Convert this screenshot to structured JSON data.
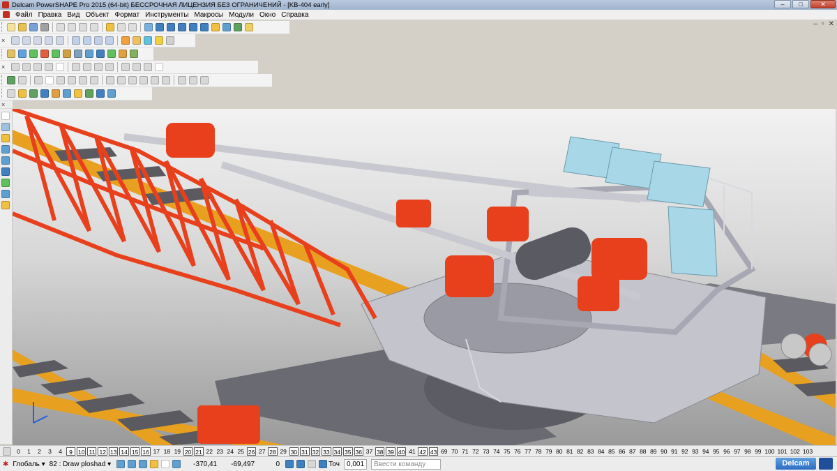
{
  "window": {
    "title": "Delcam PowerSHAPE Pro 2015 (64-bit) БЕССРОЧНАЯ ЛИЦЕНЗИЯ БЕЗ ОГРАНИЧЕНИЙ - [KB-404 early]",
    "min": "–",
    "max": "□",
    "close": "✕"
  },
  "menu": [
    "Файл",
    "Правка",
    "Вид",
    "Объект",
    "Формат",
    "Инструменты",
    "Макросы",
    "Модули",
    "Окно",
    "Справка"
  ],
  "mdi_controls": {
    "min": "–",
    "restore": "▫",
    "close": "✕"
  },
  "toolbar_close": "×",
  "levels": [
    "0",
    "1",
    "2",
    "3",
    "4",
    "9",
    "10",
    "11",
    "12",
    "13",
    "14",
    "15",
    "16",
    "17",
    "18",
    "19",
    "20",
    "21",
    "22",
    "23",
    "24",
    "25",
    "26",
    "27",
    "28",
    "29",
    "30",
    "31",
    "32",
    "33",
    "34",
    "35",
    "36",
    "37",
    "38",
    "39",
    "40",
    "41",
    "42",
    "43",
    "69",
    "70",
    "71",
    "72",
    "73",
    "74",
    "75",
    "76",
    "77",
    "78",
    "79",
    "80",
    "81",
    "82",
    "83",
    "84",
    "85",
    "86",
    "87",
    "88",
    "89",
    "90",
    "91",
    "92",
    "93",
    "94",
    "95",
    "96",
    "97",
    "98",
    "99",
    "100",
    "101",
    "102",
    "103"
  ],
  "levels_on": [
    "9",
    "10",
    "11",
    "12",
    "13",
    "14",
    "15",
    "16",
    "20",
    "21",
    "26",
    "28",
    "30",
    "31",
    "32",
    "33",
    "34",
    "35",
    "36",
    "38",
    "39",
    "40",
    "42",
    "43"
  ],
  "status": {
    "workplane": "Глобаль",
    "workplane_arrow": "▾",
    "layer": "82 : Draw ploshad",
    "layer_arrow": "▾",
    "x": "-370,41",
    "y": "-69,497",
    "z": "0",
    "tol_label": "Точ",
    "tol": "0,001",
    "cmd_placeholder": "Ввести команду"
  },
  "brand": "Delcam",
  "colors": {
    "crane_orange": "#e8401c",
    "crane_grey": "#c4c4cc",
    "rail_yellow": "#e8a020",
    "tie_grey": "#5a5a60",
    "cabinet_blue": "#a8d8e8",
    "bg_top": "#f2f2f2",
    "bg_bottom": "#9a9a9a"
  }
}
